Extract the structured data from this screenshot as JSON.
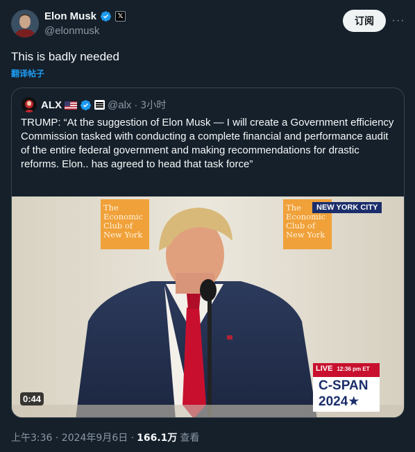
{
  "author": {
    "display_name": "Elon Musk",
    "handle": "@elonmusk",
    "verified_icon": "verified-badge-icon",
    "affiliation_icon": "x-logo-icon",
    "affiliation_glyph": "𝕏"
  },
  "subscribe_label": "订阅",
  "more_label": "···",
  "tweet_text": "This is badly needed",
  "translate_label": "翻译帖子",
  "quote": {
    "display_name": "ALX",
    "handle": "@alx",
    "separator": "·",
    "time": "3小时",
    "text": "TRUMP: “At the suggestion of Elon Musk — I will create a Government efficiency Commission tasked with conducting a complete financial and performance audit of the entire federal government and making recommendations for drastic reforms. Elon.. has agreed to head that task force”",
    "video": {
      "duration": "0:44",
      "sign_left": [
        "The",
        "Economic",
        "Club of",
        "New York"
      ],
      "sign_right": [
        "The",
        "Economic",
        "Club of",
        "New York"
      ],
      "location_badge": "NEW YORK CITY",
      "live_label": "LIVE",
      "live_time": "12:36 pm ET",
      "network": "C-SPAN",
      "network_year": "2024★"
    }
  },
  "meta": {
    "timestamp": "上午3:36 · 2024年9月6日 ·",
    "views": "166.1万",
    "views_label": "查看"
  },
  "colors": {
    "background": "#15202b",
    "accent": "#1d9bf0",
    "text": "#f7f9f9",
    "secondary": "#8b98a5",
    "border": "#38444d"
  }
}
